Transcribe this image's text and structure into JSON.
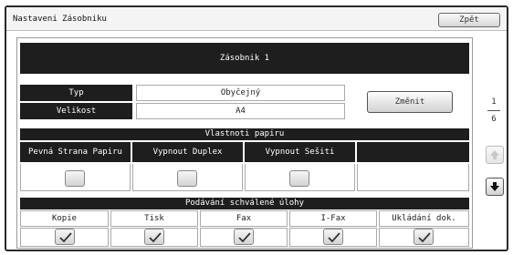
{
  "window": {
    "title": "Nastaveni Zásobniku",
    "back_label": "Zpět"
  },
  "tray": {
    "header": "Zásobnik 1",
    "type_label": "Typ",
    "type_value": "Obyčejný",
    "size_label": "Velikost",
    "size_value": "A4",
    "change_label": "Změnit"
  },
  "paper_properties": {
    "header": "Vlastnoti papiru",
    "columns": [
      "Pevná Strana Papiru",
      "Vypnout Duplex",
      "Vypnout Sešiti",
      ""
    ],
    "checked": [
      false,
      false,
      false
    ]
  },
  "approved_jobs": {
    "header": "Podávání schválené úlohy",
    "columns": [
      "Kopie",
      "Tisk",
      "Fax",
      "I-Fax",
      "Ukládání dok."
    ],
    "checked": [
      true,
      true,
      true,
      true,
      true
    ]
  },
  "pager": {
    "current": "1",
    "total": "6"
  },
  "icons": {
    "up": "arrow-up-icon",
    "down": "arrow-down-icon",
    "check": "checkmark-icon"
  }
}
